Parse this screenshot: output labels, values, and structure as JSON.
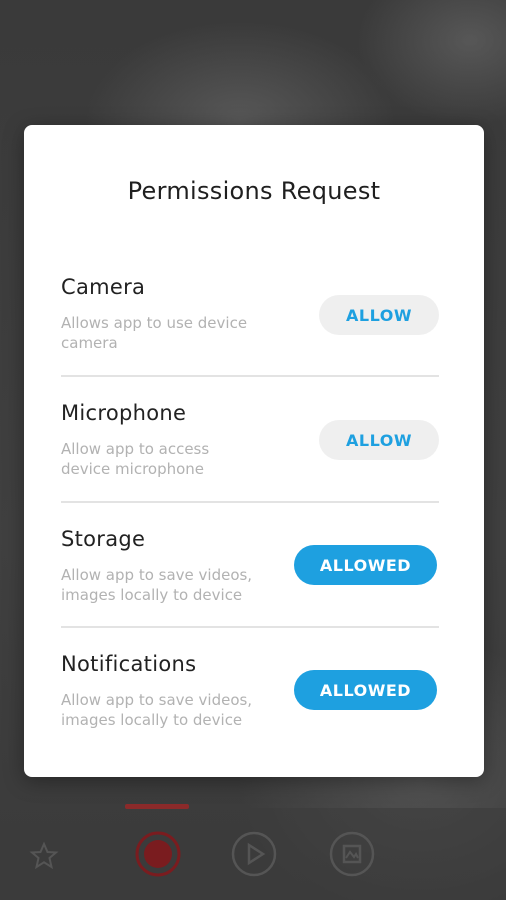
{
  "modal": {
    "title": "Permissions Request"
  },
  "permissions": [
    {
      "name": "Camera",
      "description": "Allows app to use device camera",
      "button": "ALLOW",
      "state": "not-allowed"
    },
    {
      "name": "Microphone",
      "description": "Allow app to access device microphone",
      "button": "ALLOW",
      "state": "not-allowed"
    },
    {
      "name": "Storage",
      "description": "Allow app to save videos, images locally to device",
      "button": "ALLOWED",
      "state": "allowed"
    },
    {
      "name": "Notifications",
      "description": "Allow app to save videos, images locally to device",
      "button": "ALLOWED",
      "state": "allowed"
    }
  ],
  "colors": {
    "accent": "#1ea0e0",
    "allow_bg": "#efefef",
    "record": "#c0262c"
  },
  "toolbar": {
    "icons": [
      "star-icon",
      "record-icon",
      "play-icon",
      "gallery-icon"
    ]
  }
}
